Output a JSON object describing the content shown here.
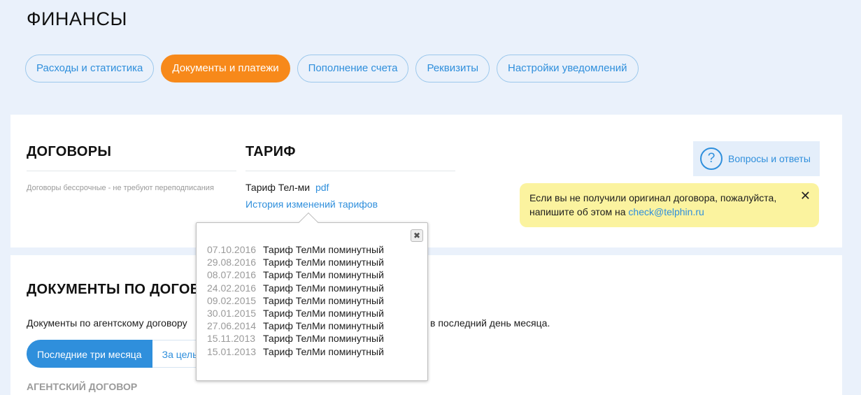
{
  "page": {
    "title": "ФИНАНСЫ"
  },
  "tabs": [
    {
      "label": "Расходы и статистика",
      "active": false
    },
    {
      "label": "Документы и платежи",
      "active": true
    },
    {
      "label": "Пополнение счета",
      "active": false
    },
    {
      "label": "Реквизиты",
      "active": false
    },
    {
      "label": "Настройки уведомлений",
      "active": false
    }
  ],
  "contracts": {
    "title": "ДОГОВОРЫ",
    "note": "Договоры бессрочные - не требуют переподписания"
  },
  "tariff": {
    "title": "ТАРИФ",
    "name": "Тариф Тел-ми",
    "pdf_label": "pdf",
    "history_link": "История изменений тарифов"
  },
  "faq": {
    "icon": "question-icon",
    "label": "Вопросы и ответы"
  },
  "notice": {
    "text": "Если вы не получили оригинал договора, пожалуйста, напишите об этом на",
    "email": "check@telphin.ru",
    "close": "✕"
  },
  "documents": {
    "title": "ДОКУМЕНТЫ ПО ДОГОВ",
    "intro_start": "Документы по агентскому договору",
    "intro_end": "в последний день месяца.",
    "periods": [
      {
        "label": "Последние три месяца",
        "active": true
      },
      {
        "label": "За целый",
        "active": false
      }
    ],
    "subheading": "АГЕНТСКИЙ ДОГОВОР"
  },
  "tariff_history": {
    "close_icon": "close-icon",
    "close_glyph": "✖",
    "entries": [
      {
        "date": "07.10.2016",
        "name": "Тариф ТелМи поминутный"
      },
      {
        "date": "29.08.2016",
        "name": "Тариф ТелМи поминутный"
      },
      {
        "date": "08.07.2016",
        "name": "Тариф ТелМи поминутный"
      },
      {
        "date": "24.02.2016",
        "name": "Тариф ТелМи поминутный"
      },
      {
        "date": "09.02.2015",
        "name": "Тариф ТелМи поминутный"
      },
      {
        "date": "30.01.2015",
        "name": "Тариф ТелМи поминутный"
      },
      {
        "date": "27.06.2014",
        "name": "Тариф ТелМи поминутный"
      },
      {
        "date": "15.11.2013",
        "name": "Тариф ТелМи поминутный"
      },
      {
        "date": "15.01.2013",
        "name": "Тариф ТелМи поминутный"
      }
    ]
  },
  "colors": {
    "accent_blue": "#2f8fdc",
    "active_tab_orange": "#f7891a",
    "notice_yellow": "#fbf39f",
    "page_background": "#eaf1fb"
  }
}
